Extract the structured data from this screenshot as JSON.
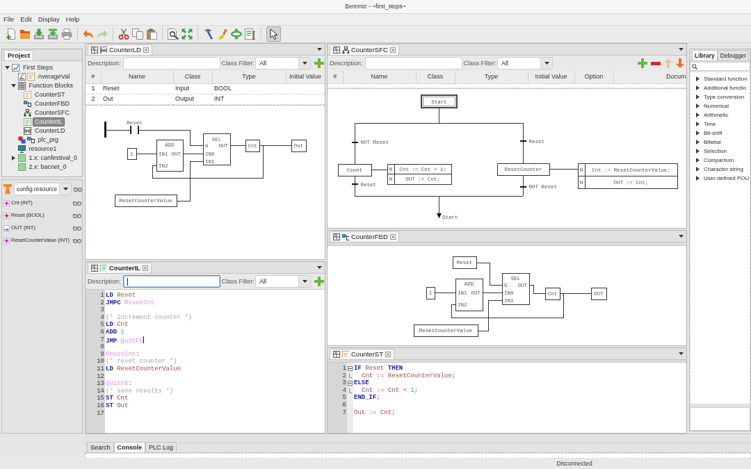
{
  "window": {
    "title": "Beremiz - ~first_steps~"
  },
  "menu": [
    "File",
    "Edit",
    "Display",
    "Help"
  ],
  "toolbar": {
    "redo": {
      "disabled": true
    },
    "pointer": {
      "selected": true
    }
  },
  "project": {
    "tab": "Project",
    "tree": [
      {
        "label": "First Steps",
        "kind": "project",
        "expanded": true,
        "selected": false,
        "children": [
          {
            "label": "AverageVal",
            "kind": "function",
            "selected": false
          },
          {
            "label": "Function Blocks",
            "kind": "folder",
            "expanded": true,
            "selected": false,
            "children": [
              {
                "label": "CounterST",
                "kind": "st",
                "selected": false
              },
              {
                "label": "CounterFBD",
                "kind": "fbd",
                "selected": false
              },
              {
                "label": "CounterSFC",
                "kind": "sfc",
                "selected": false
              },
              {
                "label": "CounterIL",
                "kind": "il",
                "selected": true
              },
              {
                "label": "CounterLD",
                "kind": "ld",
                "selected": false
              }
            ]
          },
          {
            "label": "plc_prg",
            "kind": "program",
            "selected": false
          },
          {
            "label": "resource1",
            "kind": "resource",
            "selected": false
          },
          {
            "label": "1.x: canfestival_0",
            "kind": "extension",
            "expanded": false,
            "selected": false
          },
          {
            "label": "2.x: bacnet_0",
            "kind": "extension",
            "selected": false
          }
        ]
      }
    ]
  },
  "debug": {
    "instance": "config.resource",
    "variables": [
      {
        "label": "Cnt (INT)",
        "kind": "local"
      },
      {
        "label": "Reset (BOOL)",
        "kind": "input"
      },
      {
        "label": "OUT (INT)",
        "kind": "output"
      },
      {
        "label": "ResetCounterValue (INT)",
        "kind": "local"
      }
    ]
  },
  "ld_editor": {
    "tab": "CounterLD",
    "active": false,
    "description_label": "Description:",
    "description_focused": false,
    "filter_label": "Class Filter:",
    "filter": "All",
    "buttons": [
      {
        "kind": "add",
        "disabled": false
      }
    ],
    "columns": [
      "#",
      "Name",
      "Class",
      "Type",
      "Initial Value"
    ],
    "rows": [
      {
        "number": "1",
        "name": "Reset",
        "class": "Input",
        "type": "BOOL"
      },
      {
        "number": "2",
        "name": "Out",
        "class": "Output",
        "type": "INT"
      }
    ],
    "diagram": {
      "contact": "Reset",
      "blocks": [
        {
          "name": "ADD",
          "inputs": [
            "IN1",
            "IN2"
          ],
          "outputs": [
            "OUT"
          ]
        },
        {
          "name": "SEL",
          "inputs": [
            "G",
            "IN0",
            "IN1"
          ],
          "outputs": [
            "OUT"
          ]
        }
      ],
      "variables": [
        "1",
        "Cnt",
        "Out",
        "ResetCounterValue"
      ]
    }
  },
  "sfc_editor": {
    "tab": "CounterSFC",
    "active": false,
    "description_label": "Description:",
    "description_focused": false,
    "filter_label": "Class Filter:",
    "filter": "All",
    "buttons": [
      {
        "kind": "add",
        "disabled": false
      },
      {
        "kind": "remove",
        "disabled": false
      },
      {
        "kind": "up",
        "disabled": true
      },
      {
        "kind": "down",
        "disabled": false
      }
    ],
    "columns": [
      "#",
      "Name",
      "Class",
      "Type",
      "Initial Value",
      "Option",
      "Docum"
    ],
    "diagram": {
      "initial_step": "Start",
      "steps": [
        {
          "name": "Count",
          "condition_in": "NOT Reset",
          "condition_out": "Reset",
          "actions": [
            {
              "qualifier": "N",
              "code": "Cnt := Cnt + 1;"
            },
            {
              "qualifier": "N",
              "code": "OUT := Cnt;"
            }
          ]
        },
        {
          "name": "ResetCounter",
          "condition_in": "Reset",
          "condition_out": "NOT Reset",
          "actions": [
            {
              "qualifier": "N",
              "code": "Cnt := ResetCounterValue;"
            },
            {
              "qualifier": "N",
              "code": "OUT := Cnt;"
            }
          ]
        }
      ],
      "jump": "Start"
    }
  },
  "library": {
    "tabs": [
      {
        "label": "Library",
        "selected": true
      },
      {
        "label": "Debugger",
        "selected": false
      }
    ],
    "categories": [
      {
        "label": "Standard function",
        "expanded": false
      },
      {
        "label": "Additional functio",
        "expanded": false
      },
      {
        "label": "Type conversion",
        "expanded": false
      },
      {
        "label": "Numerical",
        "expanded": false
      },
      {
        "label": "Arithmetic",
        "expanded": false
      },
      {
        "label": "Time",
        "expanded": false
      },
      {
        "label": "Bit-shift",
        "expanded": false
      },
      {
        "label": "Bitwise",
        "expanded": false
      },
      {
        "label": "Selection",
        "expanded": false
      },
      {
        "label": "Comparison",
        "expanded": false
      },
      {
        "label": "Character string",
        "expanded": false
      },
      {
        "label": "User-defined POU",
        "expanded": false
      }
    ]
  },
  "il_editor": {
    "tab": "CounterIL",
    "active": true,
    "description_label": "Description:",
    "description_focused": true,
    "filter_label": "Class Filter:",
    "filter": "All",
    "buttons": [
      {
        "kind": "add",
        "disabled": false
      }
    ],
    "lines": [
      {
        "number": "1",
        "tokens": [
          {
            "kind": "keyword",
            "text": "LD"
          },
          {
            "kind": "variable",
            "text": "Reset"
          }
        ]
      },
      {
        "number": "2",
        "tokens": [
          {
            "kind": "keyword",
            "text": "JMPC"
          },
          {
            "kind": "label",
            "text": "ResetCnt"
          }
        ]
      },
      {
        "number": "3"
      },
      {
        "number": "4",
        "tokens": [
          {
            "kind": "comment",
            "text": "(* increment counter *)"
          }
        ]
      },
      {
        "number": "5",
        "tokens": [
          {
            "kind": "keyword",
            "text": "LD"
          },
          {
            "kind": "variable",
            "text": "Cnt"
          }
        ]
      },
      {
        "number": "6",
        "tokens": [
          {
            "kind": "keyword",
            "text": "ADD"
          },
          {
            "kind": "number",
            "text": "1"
          }
        ]
      },
      {
        "number": "7",
        "caret": true,
        "tokens": [
          {
            "kind": "keyword",
            "text": "JMP"
          },
          {
            "kind": "label",
            "text": "QuitFb"
          }
        ]
      },
      {
        "number": "8"
      },
      {
        "number": "9",
        "tokens": [
          {
            "kind": "label",
            "text": "ResetCnt"
          },
          {
            "kind": "punct",
            "text": ":"
          }
        ]
      },
      {
        "number": "10",
        "tokens": [
          {
            "kind": "comment",
            "text": "(* reset counter *)"
          }
        ]
      },
      {
        "number": "11",
        "tokens": [
          {
            "kind": "keyword",
            "text": "LD"
          },
          {
            "kind": "variable",
            "text": "ResetCounterValue"
          }
        ]
      },
      {
        "number": "12"
      },
      {
        "number": "13",
        "tokens": [
          {
            "kind": "label",
            "text": "QuitFb"
          },
          {
            "kind": "punct",
            "text": ":"
          }
        ]
      },
      {
        "number": "14",
        "tokens": [
          {
            "kind": "comment",
            "text": "(* save results *)"
          }
        ]
      },
      {
        "number": "15",
        "tokens": [
          {
            "kind": "keyword",
            "text": "ST"
          },
          {
            "kind": "variable",
            "text": "Cnt"
          }
        ]
      },
      {
        "number": "16",
        "tokens": [
          {
            "kind": "keyword",
            "text": "ST"
          },
          {
            "kind": "variable",
            "text": "Out"
          }
        ]
      },
      {
        "number": "17"
      }
    ]
  },
  "fbd_editor": {
    "tab": "CounterFBD",
    "active": false,
    "diagram": {
      "blocks": [
        {
          "name": "ADD",
          "inputs": [
            "IN1",
            "IN2"
          ],
          "outputs": [
            "OUT"
          ]
        },
        {
          "name": "SEL",
          "inputs": [
            "G",
            "IN0",
            "IN1"
          ],
          "outputs": [
            "OUT"
          ]
        }
      ],
      "variables": [
        "Reset",
        "1",
        "Cnt",
        "OUT",
        "ResetCounterValue"
      ]
    }
  },
  "st_editor": {
    "tab": "CounterST",
    "active": false,
    "lines": [
      {
        "number": "1",
        "expanded": true,
        "tokens": [
          {
            "kind": "keyword",
            "text": "IF"
          },
          {
            "kind": "variable",
            "text": "Reset"
          },
          {
            "kind": "keyword",
            "text": "THEN"
          }
        ],
        "children": [
          {
            "number": "2",
            "tokens": [
              {
                "kind": "variable",
                "text": "Cnt"
              },
              {
                "kind": "operator",
                "text": ":="
              },
              {
                "kind": "variable",
                "text": "ResetCounterValue"
              },
              {
                "kind": "punct",
                "text": ";"
              }
            ]
          }
        ]
      },
      {
        "number": "3",
        "expanded": true,
        "tokens": [
          {
            "kind": "keyword",
            "text": "ELSE"
          }
        ],
        "children": [
          {
            "number": "4",
            "tokens": [
              {
                "kind": "variable",
                "text": "Cnt"
              },
              {
                "kind": "operator",
                "text": ":="
              },
              {
                "kind": "variable",
                "text": "Cnt"
              },
              {
                "kind": "operator",
                "text": "+"
              },
              {
                "kind": "number",
                "text": "1"
              },
              {
                "kind": "punct",
                "text": ";"
              }
            ]
          }
        ]
      },
      {
        "number": "5",
        "tokens": [
          {
            "kind": "keyword",
            "text": "END_IF"
          },
          {
            "kind": "punct",
            "text": ";"
          }
        ]
      },
      {
        "number": "6"
      },
      {
        "number": "7",
        "tokens": [
          {
            "kind": "variable",
            "text": "Out"
          },
          {
            "kind": "operator",
            "text": ":="
          },
          {
            "kind": "variable",
            "text": "Cnt"
          },
          {
            "kind": "punct",
            "text": ";"
          }
        ]
      }
    ]
  },
  "bottom_panel": {
    "tabs": [
      {
        "label": "Search",
        "selected": false
      },
      {
        "label": "Console",
        "selected": true
      },
      {
        "label": "PLC Log",
        "selected": false
      }
    ]
  },
  "status_bar": {
    "connection": "Disconnected"
  }
}
